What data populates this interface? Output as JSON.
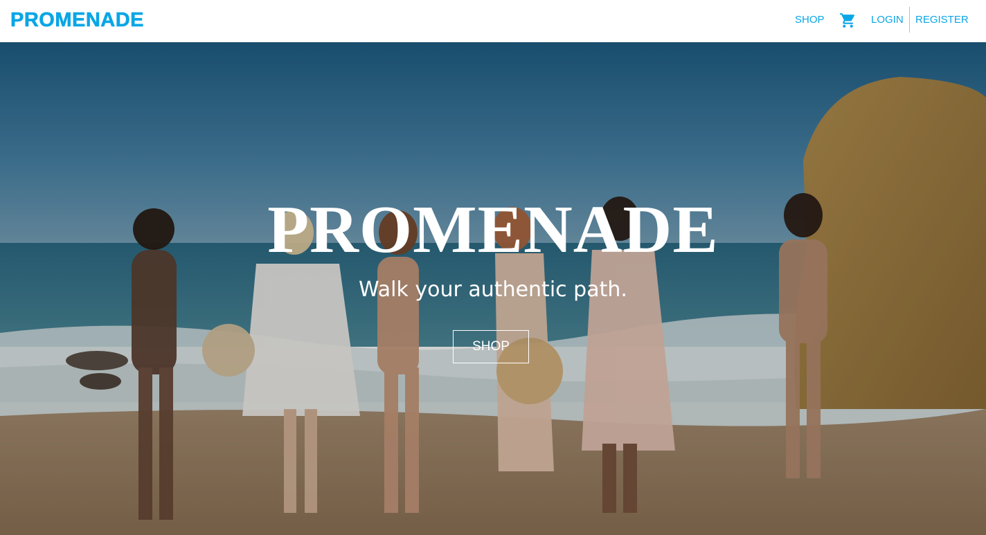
{
  "brand": {
    "name": "PROMENADE",
    "color": "#0aa6e6"
  },
  "nav": {
    "shop_label": "SHOP",
    "cart_icon": "shopping-cart-icon",
    "login_label": "LOGIN",
    "register_label": "REGISTER"
  },
  "hero": {
    "title": "PROMENADE",
    "subtitle": "Walk your authentic path.",
    "button_label": "SHOP",
    "background_image": "beach-group-photo"
  }
}
